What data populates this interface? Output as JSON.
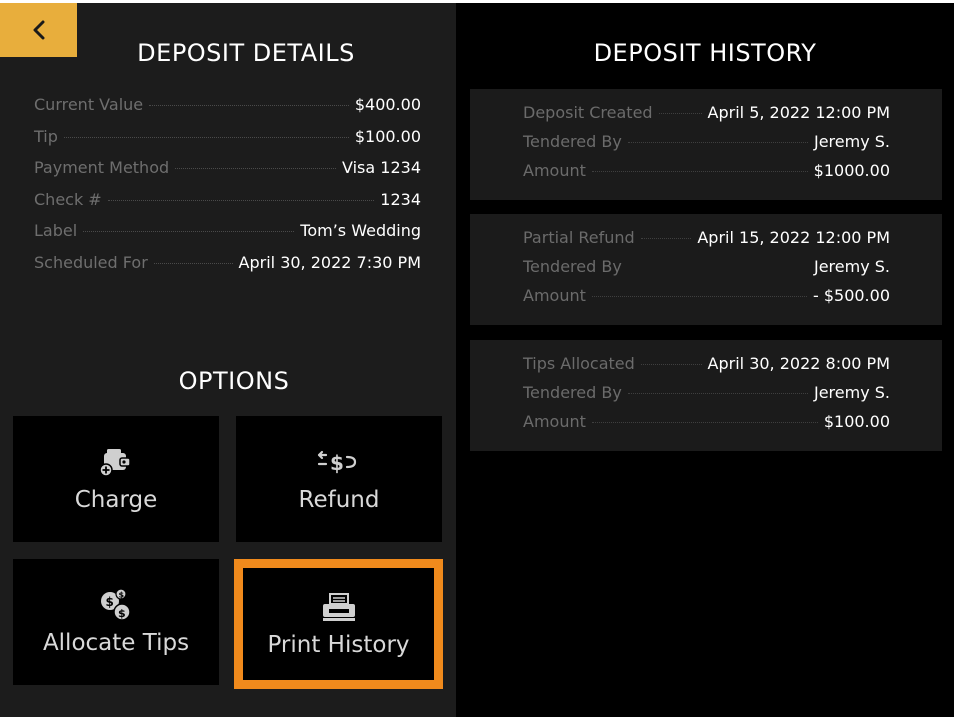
{
  "header": {
    "back_icon": "chevron-left-icon",
    "accent_color": "#e8ae3c"
  },
  "deposit_details": {
    "title": "DEPOSIT DETAILS",
    "rows": [
      {
        "label": "Current Value",
        "value": "$400.00"
      },
      {
        "label": "Tip",
        "value": "$100.00"
      },
      {
        "label": "Payment Method",
        "value": "Visa 1234"
      },
      {
        "label": "Check #",
        "value": "1234"
      },
      {
        "label": "Label",
        "value": "Tom’s Wedding"
      },
      {
        "label": "Scheduled For",
        "value": "April 30, 2022 7:30 PM"
      }
    ]
  },
  "options": {
    "title": "OPTIONS",
    "buttons": [
      {
        "label": "Charge",
        "icon": "wallet-add-icon"
      },
      {
        "label": "Refund",
        "icon": "refund-dollar-icon"
      },
      {
        "label": "Allocate Tips",
        "icon": "coins-icon"
      },
      {
        "label": "Print History",
        "icon": "printer-icon",
        "selected": true
      }
    ],
    "highlight_color": "#f08a1c"
  },
  "deposit_history": {
    "title": "DEPOSIT HISTORY",
    "entries": [
      {
        "rows": [
          {
            "label": "Deposit Created",
            "value": "April 5, 2022 12:00 PM"
          },
          {
            "label": "Tendered By",
            "value": "Jeremy S."
          },
          {
            "label": "Amount",
            "value": "$1000.00"
          }
        ]
      },
      {
        "rows": [
          {
            "label": "Partial Refund",
            "value": "April 15, 2022 12:00 PM"
          },
          {
            "label": "Tendered By",
            "value": "Jeremy S."
          },
          {
            "label": "Amount",
            "value": "- $500.00"
          }
        ]
      },
      {
        "rows": [
          {
            "label": "Tips Allocated",
            "value": "April 30, 2022 8:00 PM"
          },
          {
            "label": "Tendered By",
            "value": "Jeremy S."
          },
          {
            "label": "Amount",
            "value": "$100.00"
          }
        ]
      }
    ]
  }
}
